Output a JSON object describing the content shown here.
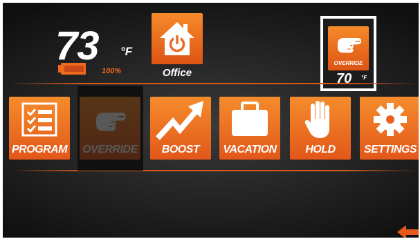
{
  "header": {
    "temperature": "73",
    "unit": "°F",
    "battery_percent": "100%",
    "battery_icon": "battery-icon"
  },
  "location": {
    "label": "Office",
    "icon": "house-power-icon"
  },
  "status": {
    "mode": "OVERRIDE",
    "setpoint": "70",
    "unit": "°F",
    "icon": "pointing-hand-icon"
  },
  "menu": {
    "program": {
      "label": "PROGRAM",
      "icon": "checklist-icon"
    },
    "override": {
      "label": "OVERRIDE",
      "icon": "pointing-hand-icon",
      "selected": true
    },
    "boost": {
      "label": "BOOST",
      "icon": "trend-up-arrow-icon"
    },
    "vacation": {
      "label": "VACATION",
      "icon": "suitcase-icon"
    },
    "hold": {
      "label": "HOLD",
      "icon": "hand-icon"
    },
    "settings": {
      "label": "SETTINGS",
      "icon": "gear-icon"
    }
  },
  "navigation": {
    "back_icon": "back-arrow-icon"
  },
  "colors": {
    "accent": "#ef6a1e",
    "tile_top": "#f58a2a",
    "tile_bottom": "#de5414",
    "background": "#1e1e1e",
    "frame": "#ffffff"
  }
}
